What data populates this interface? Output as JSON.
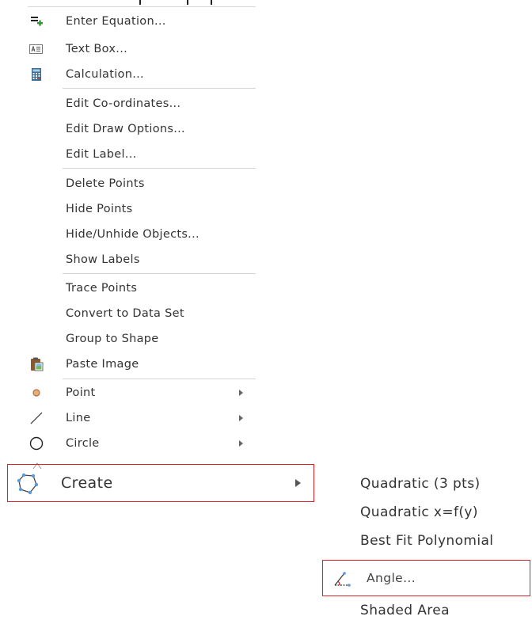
{
  "menu": {
    "items": [
      {
        "label": "Enter Equation...",
        "icon": "enter-equation-icon"
      },
      {
        "label": "Text Box...",
        "icon": "text-box-icon"
      },
      {
        "label": "Calculation...",
        "icon": "calculator-icon"
      },
      {
        "label": "Edit Co-ordinates..."
      },
      {
        "label": "Edit Draw Options..."
      },
      {
        "label": "Edit Label..."
      },
      {
        "label": "Delete Points"
      },
      {
        "label": "Hide Points"
      },
      {
        "label": "Hide/Unhide Objects..."
      },
      {
        "label": "Show Labels"
      },
      {
        "label": "Trace Points"
      },
      {
        "label": "Convert to Data Set"
      },
      {
        "label": "Group to Shape"
      },
      {
        "label": "Paste Image",
        "icon": "paste-image-icon"
      },
      {
        "label": "Point",
        "icon": "point-icon",
        "has_submenu": true
      },
      {
        "label": "Line",
        "icon": "line-icon",
        "has_submenu": true
      },
      {
        "label": "Circle",
        "icon": "circle-icon",
        "has_submenu": true
      }
    ],
    "create": {
      "label": "Create",
      "icon": "polygon-icon",
      "has_submenu": true,
      "highlighted": true
    }
  },
  "submenu": {
    "items": [
      {
        "label": "Quadratic (3 pts)"
      },
      {
        "label": "Quadratic x=f(y)"
      },
      {
        "label": "Best Fit Polynomial"
      },
      {
        "label": "Angle...",
        "icon": "angle-icon",
        "highlighted": true
      },
      {
        "label": "Shaded Area"
      }
    ]
  },
  "colors": {
    "highlight_border": "#d9232b",
    "text": "#333333",
    "separator": "#d4d4d4"
  }
}
